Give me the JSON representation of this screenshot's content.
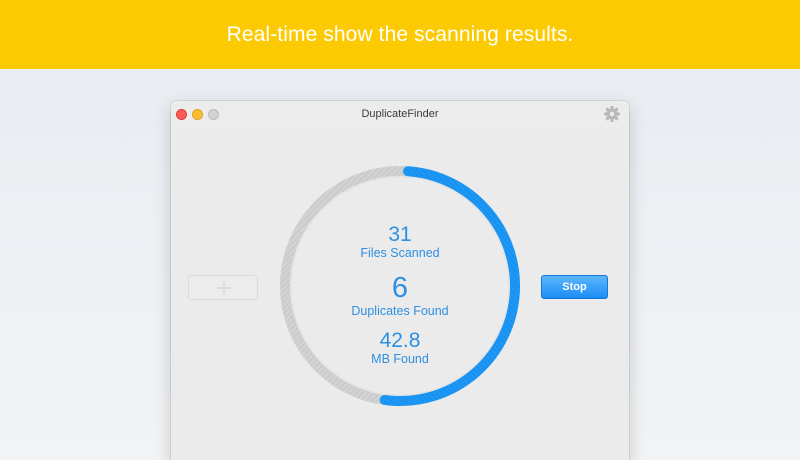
{
  "banner": {
    "text": "Real-time show the scanning results."
  },
  "window": {
    "title": "DuplicateFinder"
  },
  "scan": {
    "progress": 0.51,
    "files_scanned": {
      "value": "31",
      "label": "Files Scanned"
    },
    "duplicates_found": {
      "value": "6",
      "label": "Duplicates Found"
    },
    "mb_found": {
      "value": "42.8",
      "label": "MB Found"
    }
  },
  "actions": {
    "stop_label": "Stop"
  },
  "icons": {
    "settings": "gear-icon",
    "add": "plus-icon"
  },
  "colors": {
    "banner": "#fcca02",
    "accent": "#2f8fe0",
    "ring_progress": "#1c95f3",
    "ring_track": "#cfcfcf",
    "close": "#fc5b57",
    "minimize": "#fdbb2e"
  }
}
